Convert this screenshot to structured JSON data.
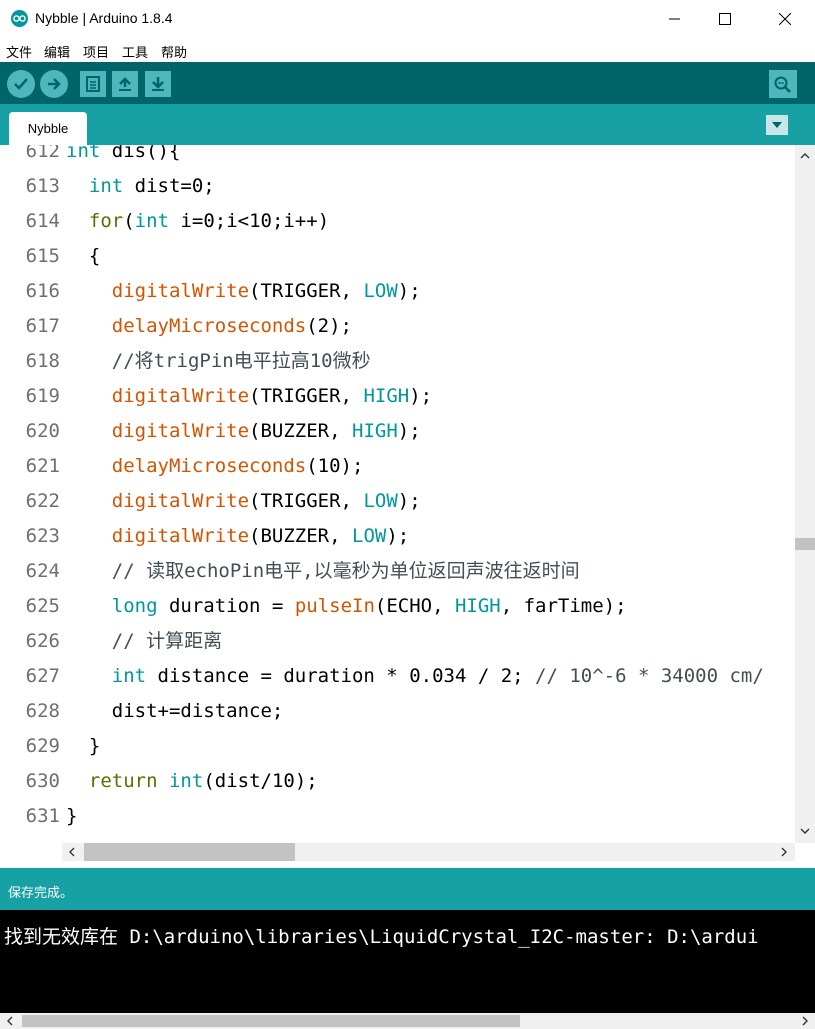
{
  "window": {
    "title": "Nybble | Arduino 1.8.4"
  },
  "menu": [
    {
      "label": "文件"
    },
    {
      "label": "编辑"
    },
    {
      "label": "项目"
    },
    {
      "label": "工具"
    },
    {
      "label": "帮助"
    }
  ],
  "toolbar": {
    "buttons": [
      "verify-icon",
      "upload-icon",
      "new-icon",
      "open-icon",
      "save-icon",
      "serial-monitor-icon"
    ]
  },
  "tabs": [
    {
      "label": "Nybble",
      "active": true
    }
  ],
  "editor": {
    "lines": [
      {
        "num": "612",
        "tokens": [
          {
            "t": "kw",
            "v": "int"
          },
          {
            "t": "p",
            "v": " dis(){"
          }
        ]
      },
      {
        "num": "613",
        "tokens": [
          {
            "t": "p",
            "v": "  "
          },
          {
            "t": "kw",
            "v": "int"
          },
          {
            "t": "p",
            "v": " dist=0;"
          }
        ]
      },
      {
        "num": "614",
        "tokens": [
          {
            "t": "p",
            "v": "  "
          },
          {
            "t": "kw2",
            "v": "for"
          },
          {
            "t": "p",
            "v": "("
          },
          {
            "t": "kw",
            "v": "int"
          },
          {
            "t": "p",
            "v": " i=0;i<10;i++)"
          }
        ]
      },
      {
        "num": "615",
        "tokens": [
          {
            "t": "p",
            "v": "  {"
          }
        ]
      },
      {
        "num": "616",
        "tokens": [
          {
            "t": "p",
            "v": "    "
          },
          {
            "t": "fn",
            "v": "digitalWrite"
          },
          {
            "t": "p",
            "v": "(TRIGGER, "
          },
          {
            "t": "kw",
            "v": "LOW"
          },
          {
            "t": "p",
            "v": ");"
          }
        ]
      },
      {
        "num": "617",
        "tokens": [
          {
            "t": "p",
            "v": "    "
          },
          {
            "t": "fn",
            "v": "delayMicroseconds"
          },
          {
            "t": "p",
            "v": "(2);"
          }
        ]
      },
      {
        "num": "618",
        "tokens": [
          {
            "t": "p",
            "v": "    "
          },
          {
            "t": "cm",
            "v": "//将trigPin电平拉高10微秒"
          }
        ]
      },
      {
        "num": "619",
        "tokens": [
          {
            "t": "p",
            "v": "    "
          },
          {
            "t": "fn",
            "v": "digitalWrite"
          },
          {
            "t": "p",
            "v": "(TRIGGER, "
          },
          {
            "t": "kw",
            "v": "HIGH"
          },
          {
            "t": "p",
            "v": ");"
          }
        ]
      },
      {
        "num": "620",
        "tokens": [
          {
            "t": "p",
            "v": "    "
          },
          {
            "t": "fn",
            "v": "digitalWrite"
          },
          {
            "t": "p",
            "v": "(BUZZER, "
          },
          {
            "t": "kw",
            "v": "HIGH"
          },
          {
            "t": "p",
            "v": ");"
          }
        ]
      },
      {
        "num": "621",
        "tokens": [
          {
            "t": "p",
            "v": "    "
          },
          {
            "t": "fn",
            "v": "delayMicroseconds"
          },
          {
            "t": "p",
            "v": "(10);"
          }
        ]
      },
      {
        "num": "622",
        "tokens": [
          {
            "t": "p",
            "v": "    "
          },
          {
            "t": "fn",
            "v": "digitalWrite"
          },
          {
            "t": "p",
            "v": "(TRIGGER, "
          },
          {
            "t": "kw",
            "v": "LOW"
          },
          {
            "t": "p",
            "v": ");"
          }
        ]
      },
      {
        "num": "623",
        "tokens": [
          {
            "t": "p",
            "v": "    "
          },
          {
            "t": "fn",
            "v": "digitalWrite"
          },
          {
            "t": "p",
            "v": "(BUZZER, "
          },
          {
            "t": "kw",
            "v": "LOW"
          },
          {
            "t": "p",
            "v": ");"
          }
        ]
      },
      {
        "num": "624",
        "tokens": [
          {
            "t": "p",
            "v": "    "
          },
          {
            "t": "cm",
            "v": "// 读取echoPin电平,以毫秒为单位返回声波往返时间"
          }
        ]
      },
      {
        "num": "625",
        "tokens": [
          {
            "t": "p",
            "v": "    "
          },
          {
            "t": "kw",
            "v": "long"
          },
          {
            "t": "p",
            "v": " duration = "
          },
          {
            "t": "fn",
            "v": "pulseIn"
          },
          {
            "t": "p",
            "v": "(ECHO, "
          },
          {
            "t": "kw",
            "v": "HIGH"
          },
          {
            "t": "p",
            "v": ", farTime);"
          }
        ]
      },
      {
        "num": "626",
        "tokens": [
          {
            "t": "p",
            "v": "    "
          },
          {
            "t": "cm",
            "v": "// 计算距离"
          }
        ]
      },
      {
        "num": "627",
        "tokens": [
          {
            "t": "p",
            "v": "    "
          },
          {
            "t": "kw",
            "v": "int"
          },
          {
            "t": "p",
            "v": " distance = duration * 0.034 / 2; "
          },
          {
            "t": "cm",
            "v": "// 10^-6 * 34000 cm/"
          }
        ]
      },
      {
        "num": "628",
        "tokens": [
          {
            "t": "p",
            "v": "    dist+=distance;"
          }
        ]
      },
      {
        "num": "629",
        "tokens": [
          {
            "t": "p",
            "v": "  }"
          }
        ]
      },
      {
        "num": "630",
        "tokens": [
          {
            "t": "p",
            "v": "  "
          },
          {
            "t": "kw2",
            "v": "return"
          },
          {
            "t": "p",
            "v": " "
          },
          {
            "t": "kw",
            "v": "int"
          },
          {
            "t": "p",
            "v": "(dist/10);"
          }
        ]
      },
      {
        "num": "631",
        "tokens": [
          {
            "t": "p",
            "v": "}"
          }
        ]
      }
    ]
  },
  "status": {
    "message": "保存完成。"
  },
  "console": {
    "text": "找到无效库在 D:\\arduino\\libraries\\LiquidCrystal_I2C-master: D:\\ardui"
  },
  "colors": {
    "toolbar_bg": "#006468",
    "tab_bar_bg": "#17a1a5",
    "keyword": "#00979c",
    "control": "#5e6d03",
    "function": "#d35400",
    "comment": "#434f54"
  }
}
